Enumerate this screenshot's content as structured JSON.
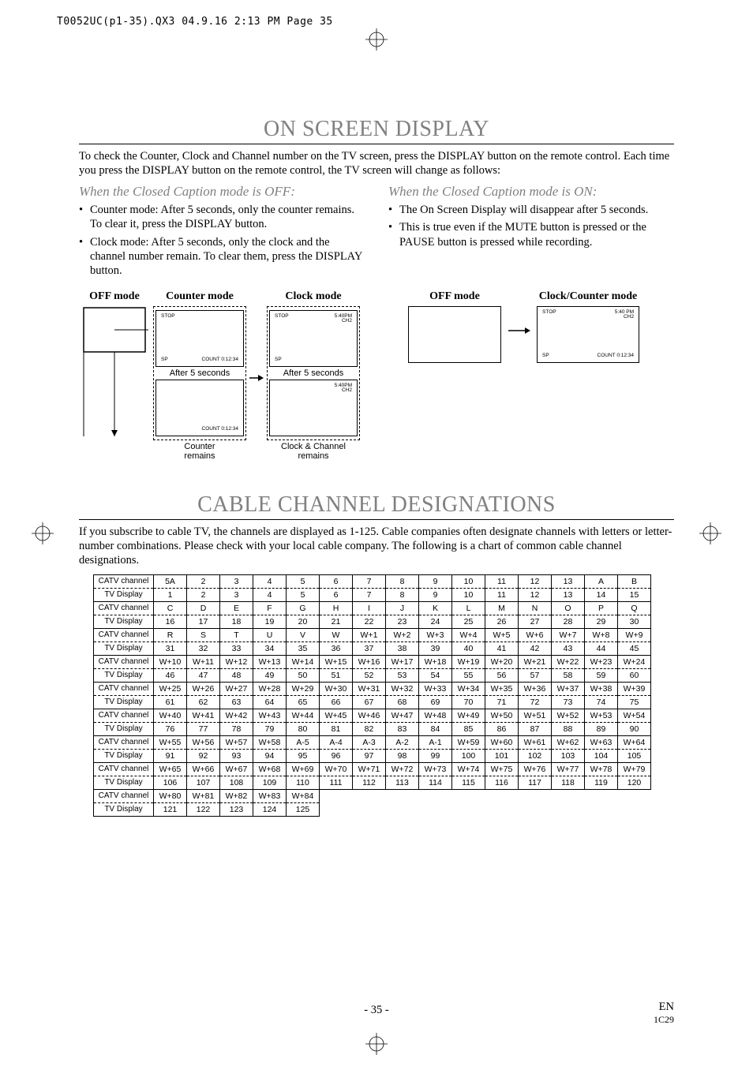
{
  "print_header": "T0052UC(p1-35).QX3  04.9.16  2:13 PM  Page 35",
  "section1": {
    "title": "ON SCREEN DISPLAY",
    "intro": "To check the Counter, Clock and Channel number on the TV screen, press the DISPLAY button on the remote control. Each time you press the DISPLAY button on the remote control, the TV screen will change as follows:",
    "left": {
      "subhead": "When the Closed Caption mode is OFF:",
      "bullets": [
        "Counter mode: After 5 seconds, only the counter remains. To clear it, press the DISPLAY button.",
        "Clock mode: After 5 seconds, only the clock and the channel number remain. To clear them, press the DISPLAY button."
      ]
    },
    "right": {
      "subhead": "When the Closed Caption mode is ON:",
      "bullets": [
        "The On Screen Display will disappear after 5 seconds.",
        "This is true even if the MUTE button is pressed or the PAUSE button is pressed while recording."
      ]
    },
    "diagram_left": {
      "mode_off": "OFF mode",
      "mode_counter": "Counter mode",
      "mode_clock": "Clock mode",
      "counter_box": {
        "stop": "STOP",
        "sp": "SP",
        "count": "COUNT  0:12:34"
      },
      "after5_left": "After 5 seconds",
      "counter_remains_box": {
        "count": "COUNT  0:12:34"
      },
      "counter_remains_caption": "Counter\nremains",
      "clock_box": {
        "stop": "STOP",
        "time": "5:40PM",
        "ch": "CH2",
        "sp": "SP"
      },
      "after5_right": "After 5 seconds",
      "clock_remains_box": {
        "time": "5:40PM",
        "ch": "CH2"
      },
      "clock_remains_caption": "Clock & Channel\nremains"
    },
    "diagram_right": {
      "mode_off": "OFF mode",
      "mode_cc": "Clock/Counter mode",
      "box": {
        "stop": "STOP",
        "time": "5:40 PM",
        "ch": "CH2",
        "sp": "SP",
        "count": "COUNT  0:12:34"
      }
    }
  },
  "section2": {
    "title": "CABLE CHANNEL DESIGNATIONS",
    "intro": "If you subscribe to cable TV, the channels are displayed as 1-125. Cable companies often designate channels with letters or letter-number combinations. Please check with your local cable company. The following is a chart of common cable channel designations.",
    "row_label_catv": "CATV channel",
    "row_label_tv": "TV Display"
  },
  "chart_data": {
    "type": "table",
    "pairs": [
      {
        "catv": [
          "5A",
          "2",
          "3",
          "4",
          "5",
          "6",
          "7",
          "8",
          "9",
          "10",
          "11",
          "12",
          "13",
          "A",
          "B"
        ],
        "tv": [
          "1",
          "2",
          "3",
          "4",
          "5",
          "6",
          "7",
          "8",
          "9",
          "10",
          "11",
          "12",
          "13",
          "14",
          "15"
        ]
      },
      {
        "catv": [
          "C",
          "D",
          "E",
          "F",
          "G",
          "H",
          "I",
          "J",
          "K",
          "L",
          "M",
          "N",
          "O",
          "P",
          "Q"
        ],
        "tv": [
          "16",
          "17",
          "18",
          "19",
          "20",
          "21",
          "22",
          "23",
          "24",
          "25",
          "26",
          "27",
          "28",
          "29",
          "30"
        ]
      },
      {
        "catv": [
          "R",
          "S",
          "T",
          "U",
          "V",
          "W",
          "W+1",
          "W+2",
          "W+3",
          "W+4",
          "W+5",
          "W+6",
          "W+7",
          "W+8",
          "W+9"
        ],
        "tv": [
          "31",
          "32",
          "33",
          "34",
          "35",
          "36",
          "37",
          "38",
          "39",
          "40",
          "41",
          "42",
          "43",
          "44",
          "45"
        ]
      },
      {
        "catv": [
          "W+10",
          "W+11",
          "W+12",
          "W+13",
          "W+14",
          "W+15",
          "W+16",
          "W+17",
          "W+18",
          "W+19",
          "W+20",
          "W+21",
          "W+22",
          "W+23",
          "W+24"
        ],
        "tv": [
          "46",
          "47",
          "48",
          "49",
          "50",
          "51",
          "52",
          "53",
          "54",
          "55",
          "56",
          "57",
          "58",
          "59",
          "60"
        ]
      },
      {
        "catv": [
          "W+25",
          "W+26",
          "W+27",
          "W+28",
          "W+29",
          "W+30",
          "W+31",
          "W+32",
          "W+33",
          "W+34",
          "W+35",
          "W+36",
          "W+37",
          "W+38",
          "W+39"
        ],
        "tv": [
          "61",
          "62",
          "63",
          "64",
          "65",
          "66",
          "67",
          "68",
          "69",
          "70",
          "71",
          "72",
          "73",
          "74",
          "75"
        ]
      },
      {
        "catv": [
          "W+40",
          "W+41",
          "W+42",
          "W+43",
          "W+44",
          "W+45",
          "W+46",
          "W+47",
          "W+48",
          "W+49",
          "W+50",
          "W+51",
          "W+52",
          "W+53",
          "W+54"
        ],
        "tv": [
          "76",
          "77",
          "78",
          "79",
          "80",
          "81",
          "82",
          "83",
          "84",
          "85",
          "86",
          "87",
          "88",
          "89",
          "90"
        ]
      },
      {
        "catv": [
          "W+55",
          "W+56",
          "W+57",
          "W+58",
          "A-5",
          "A-4",
          "A-3",
          "A-2",
          "A-1",
          "W+59",
          "W+60",
          "W+61",
          "W+62",
          "W+63",
          "W+64"
        ],
        "tv": [
          "91",
          "92",
          "93",
          "94",
          "95",
          "96",
          "97",
          "98",
          "99",
          "100",
          "101",
          "102",
          "103",
          "104",
          "105"
        ]
      },
      {
        "catv": [
          "W+65",
          "W+66",
          "W+67",
          "W+68",
          "W+69",
          "W+70",
          "W+71",
          "W+72",
          "W+73",
          "W+74",
          "W+75",
          "W+76",
          "W+77",
          "W+78",
          "W+79"
        ],
        "tv": [
          "106",
          "107",
          "108",
          "109",
          "110",
          "111",
          "112",
          "113",
          "114",
          "115",
          "116",
          "117",
          "118",
          "119",
          "120"
        ]
      },
      {
        "catv": [
          "W+80",
          "W+81",
          "W+82",
          "W+83",
          "W+84"
        ],
        "tv": [
          "121",
          "122",
          "123",
          "124",
          "125"
        ]
      }
    ]
  },
  "footer": {
    "pagenum": "- 35 -",
    "en": "EN",
    "code": "1C29"
  }
}
